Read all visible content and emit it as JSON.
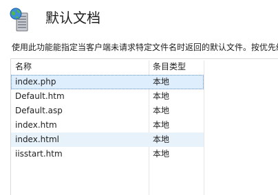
{
  "page": {
    "title": "默认文档",
    "description": "使用此功能能指定当客户端未请求特定文件名时返回的默认文件。按优先级"
  },
  "list": {
    "columns": {
      "name": "名称",
      "entry_type": "条目类型"
    },
    "rows": [
      {
        "name": "index.php",
        "entry_type": "本地",
        "state": "selected"
      },
      {
        "name": "Default.htm",
        "entry_type": "本地",
        "state": ""
      },
      {
        "name": "Default.asp",
        "entry_type": "本地",
        "state": ""
      },
      {
        "name": "index.htm",
        "entry_type": "本地",
        "state": ""
      },
      {
        "name": "index.html",
        "entry_type": "本地",
        "state": "hover"
      },
      {
        "name": "iisstart.htm",
        "entry_type": "本地",
        "state": ""
      }
    ]
  },
  "icons": {
    "header": "default-document-globe-icon"
  },
  "colors": {
    "selection": "#dfeefc",
    "hover": "#e8f2fb",
    "border": "#d9d9d9"
  }
}
